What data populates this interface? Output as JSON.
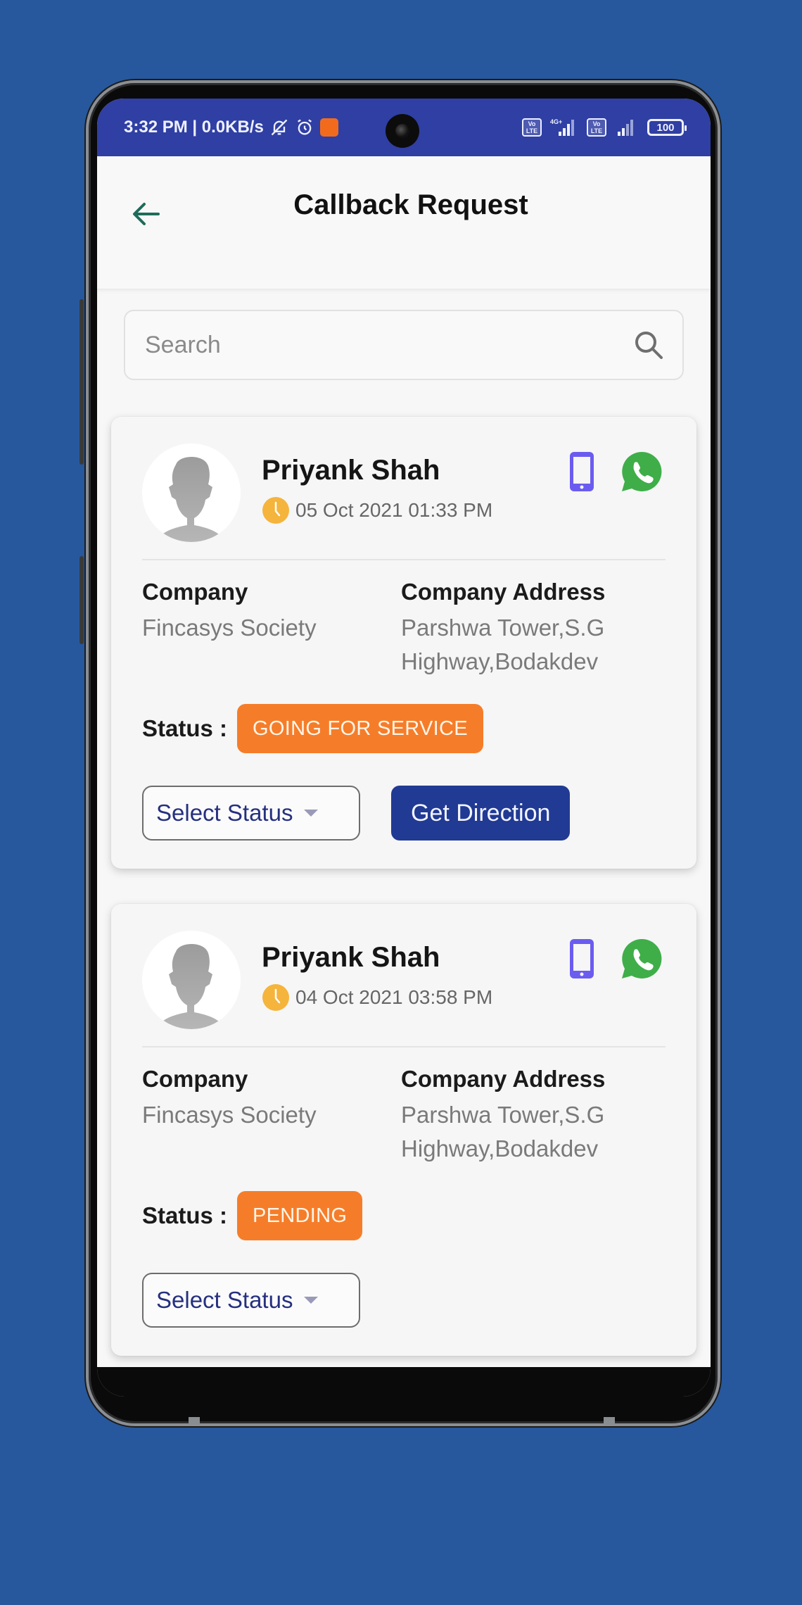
{
  "status_bar": {
    "time_text": "3:32 PM | 0.0KB/s",
    "net1_label": "Vo LTE",
    "net1_type": "4G+",
    "net2_label": "Vo LTE",
    "battery": "100",
    "icons": [
      "bell-off-icon",
      "alarm-icon",
      "app-notification-icon",
      "volte-icon",
      "signal-icon",
      "battery-icon"
    ]
  },
  "header": {
    "title": "Callback Request",
    "back_icon": "arrow-left-icon"
  },
  "search": {
    "placeholder": "Search",
    "value": ""
  },
  "colors": {
    "background": "#27589d",
    "status_bar": "#2f3fa3",
    "status_badge": "#f57d2a",
    "primary_button": "#213a93",
    "phone_icon": "#6b5cf0",
    "whatsapp": "#3fae49",
    "clock": "#f5b43c"
  },
  "cards": [
    {
      "name": "Priyank Shah",
      "datetime": "05 Oct 2021 01:33 PM",
      "company_label": "Company",
      "company": "Fincasys Society",
      "address_label": "Company Address",
      "address": "Parshwa Tower,S.G Highway,Bodakdev",
      "status_label": "Status :",
      "status": "GOING FOR SERVICE",
      "select_label": "Select Status",
      "direction_label": "Get Direction"
    },
    {
      "name": "Priyank Shah",
      "datetime": "04 Oct 2021 03:58 PM",
      "company_label": "Company",
      "company": "Fincasys Society",
      "address_label": "Company Address",
      "address": "Parshwa Tower,S.G Highway,Bodakdev",
      "status_label": "Status :",
      "status": "PENDING",
      "select_label": "Select Status"
    }
  ]
}
